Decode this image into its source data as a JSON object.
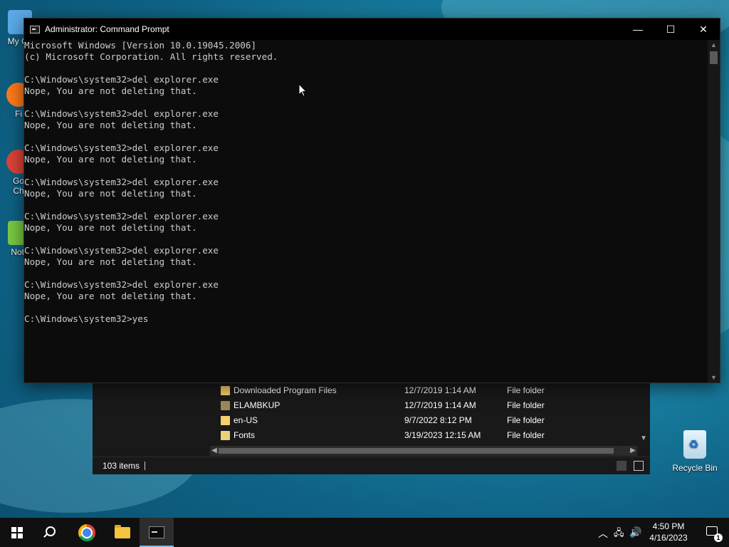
{
  "desktop": {
    "icons": [
      {
        "label": "My Co",
        "color": "#5aa9e6"
      },
      {
        "label": "Fi",
        "color": "#ff7a1a"
      },
      {
        "label": "Go\nCh",
        "color": "#db4437"
      },
      {
        "label": "Note",
        "color": "#7ac943"
      }
    ],
    "recycle_bin": "Recycle Bin"
  },
  "cmd_window": {
    "title": "Administrator: Command Prompt",
    "buttons": {
      "minimize": "—",
      "maximize": "☐",
      "close": "✕"
    },
    "lines": [
      "Microsoft Windows [Version 10.0.19045.2006]",
      "(c) Microsoft Corporation. All rights reserved.",
      "",
      "C:\\Windows\\system32>del explorer.exe",
      "Nope, You are not deleting that.",
      "",
      "C:\\Windows\\system32>del explorer.exe",
      "Nope, You are not deleting that.",
      "",
      "C:\\Windows\\system32>del explorer.exe",
      "Nope, You are not deleting that.",
      "",
      "C:\\Windows\\system32>del explorer.exe",
      "Nope, You are not deleting that.",
      "",
      "C:\\Windows\\system32>del explorer.exe",
      "Nope, You are not deleting that.",
      "",
      "C:\\Windows\\system32>del explorer.exe",
      "Nope, You are not deleting that.",
      "",
      "C:\\Windows\\system32>del explorer.exe",
      "Nope, You are not deleting that.",
      "",
      "C:\\Windows\\system32>yes"
    ]
  },
  "explorer": {
    "rows": [
      {
        "name": "Downloaded Program Files",
        "date": "12/7/2019 1:14 AM",
        "type": "File folder"
      },
      {
        "name": "ELAMBKUP",
        "date": "12/7/2019 1:14 AM",
        "type": "File folder"
      },
      {
        "name": "en-US",
        "date": "9/7/2022 8:12 PM",
        "type": "File folder"
      },
      {
        "name": "Fonts",
        "date": "3/19/2023 12:15 AM",
        "type": "File folder"
      }
    ],
    "status": "103 items"
  },
  "taskbar": {
    "items": [
      "start-icon",
      "search-icon",
      "chrome-icon",
      "file-explorer-icon",
      "command-prompt-icon"
    ],
    "tray": {
      "time": "4:50 PM",
      "date": "4/16/2023",
      "notifications": "1"
    }
  }
}
